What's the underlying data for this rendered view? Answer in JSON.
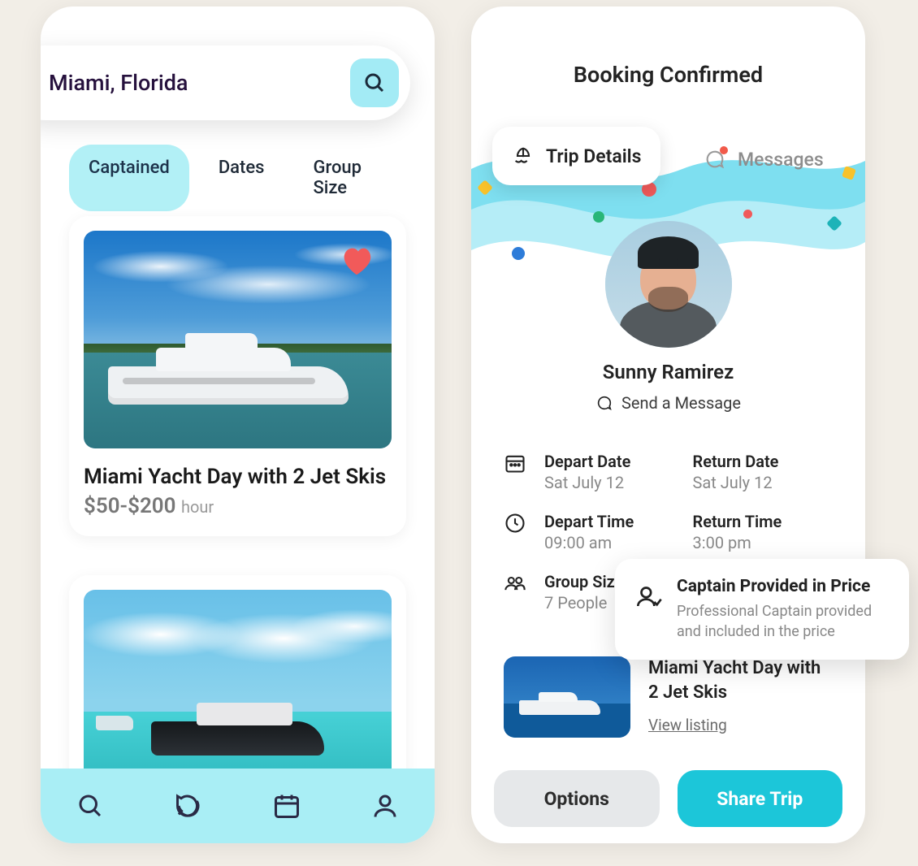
{
  "search": {
    "value": "Miami, Florida"
  },
  "filters": {
    "captained": "Captained",
    "dates": "Dates",
    "group_size": "Group Size"
  },
  "listing1": {
    "title": "Miami Yacht Day with 2 Jet Skis",
    "price": "$50-$200",
    "unit": "hour"
  },
  "confirm": {
    "title": "Booking Confirmed",
    "tab_trip": "Trip Details",
    "tab_messages": "Messages",
    "captain_name": "Sunny Ramirez",
    "send_msg": "Send a Message",
    "depart_date_label": "Depart Date",
    "depart_date_val": "Sat July 12",
    "return_date_label": "Return Date",
    "return_date_val": "Sat July 12",
    "depart_time_label": "Depart Time",
    "depart_time_val": "09:00 am",
    "return_time_label": "Return Time",
    "return_time_val": "3:00 pm",
    "group_label": "Group Size",
    "group_val": "7 People",
    "listing_title": "Miami Yacht Day with 2 Jet Skis",
    "view_listing": "View listing",
    "options_btn": "Options",
    "share_btn": "Share Trip"
  },
  "tooltip": {
    "title": "Captain Provided in Price",
    "body": "Professional Captain provided and included in the price"
  }
}
